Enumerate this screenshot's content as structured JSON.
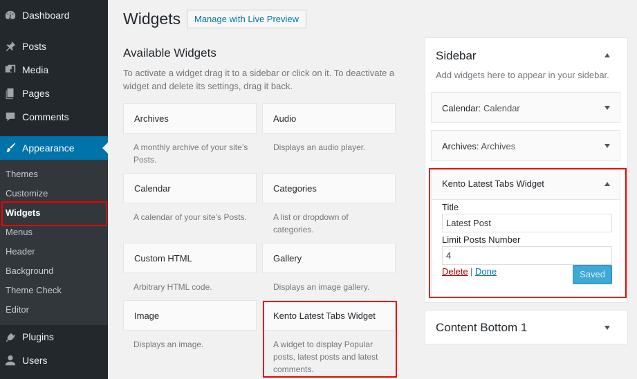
{
  "menu": {
    "dashboard": "Dashboard",
    "posts": "Posts",
    "media": "Media",
    "pages": "Pages",
    "comments": "Comments",
    "appearance": "Appearance",
    "plugins": "Plugins",
    "users": "Users"
  },
  "submenu": [
    "Themes",
    "Customize",
    "Widgets",
    "Menus",
    "Header",
    "Background",
    "Theme Check",
    "Editor"
  ],
  "header": {
    "title": "Widgets",
    "live_preview_button": "Manage with Live Preview"
  },
  "available": {
    "title": "Available Widgets",
    "description": "To activate a widget drag it to a sidebar or click on it. To deactivate a widget and delete its settings, drag it back.",
    "widgets": [
      {
        "name": "Archives",
        "desc": "A monthly archive of your site’s Posts."
      },
      {
        "name": "Audio",
        "desc": "Displays an audio player."
      },
      {
        "name": "Calendar",
        "desc": "A calendar of your site’s Posts."
      },
      {
        "name": "Categories",
        "desc": "A list or dropdown of categories."
      },
      {
        "name": "Custom HTML",
        "desc": "Arbitrary HTML code."
      },
      {
        "name": "Gallery",
        "desc": "Displays an image gallery."
      },
      {
        "name": "Image",
        "desc": "Displays an image."
      },
      {
        "name": "Kento Latest Tabs Widget",
        "desc": "A widget to display Popular posts, latest posts and latest comments."
      }
    ]
  },
  "sidebar_area": {
    "title": "Sidebar",
    "description": "Add widgets here to appear in your sidebar.",
    "widgets": [
      {
        "type": "Calendar:",
        "title": "Calendar"
      },
      {
        "type": "Archives:",
        "title": "Archives"
      }
    ],
    "kento": {
      "title": "Kento Latest Tabs Widget",
      "title_label": "Title",
      "title_value": "Latest Post",
      "limit_label": "Limit Posts Number",
      "limit_value": "4",
      "delete": "Delete",
      "separator": "|",
      "done": "Done",
      "saved": "Saved"
    }
  },
  "content_bottom": {
    "title": "Content Bottom 1"
  },
  "colors": {
    "admin_bar": "#23282d",
    "accent": "#0073aa",
    "highlight": "#e00000"
  }
}
